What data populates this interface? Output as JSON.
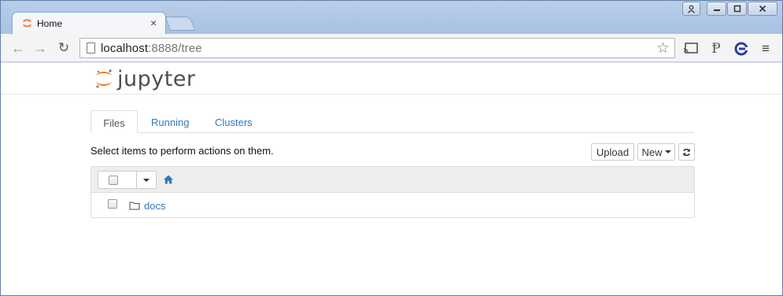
{
  "browser": {
    "tab_title": "Home",
    "tab_close": "×",
    "url_host": "localhost",
    "url_rest": ":8888/tree",
    "controls": {
      "user": "👤",
      "minimize": "—",
      "maximize": "□",
      "close": "✕"
    },
    "nav": {
      "back": "←",
      "forward": "→",
      "reload": "↻"
    },
    "icons": [
      "favicon-icon",
      "page-icon",
      "star-icon",
      "cast-icon",
      "p-extension-icon",
      "c-extension-icon",
      "menu-icon"
    ],
    "menu_glyph": "≡",
    "star_glyph": "☆",
    "p_glyph": "Ᵽ"
  },
  "jupyter": {
    "logo_text": "jupyter",
    "tabs": [
      {
        "label": "Files",
        "active": true
      },
      {
        "label": "Running",
        "active": false
      },
      {
        "label": "Clusters",
        "active": false
      }
    ],
    "instructions": "Select items to perform actions on them.",
    "buttons": {
      "upload": "Upload",
      "new": "New",
      "refresh": "↻"
    },
    "items": [
      {
        "type": "folder",
        "name": "docs"
      }
    ]
  },
  "colors": {
    "link": "#337ab7",
    "logo_orange": "#f37726",
    "list_header_bg": "#eeeeee"
  }
}
